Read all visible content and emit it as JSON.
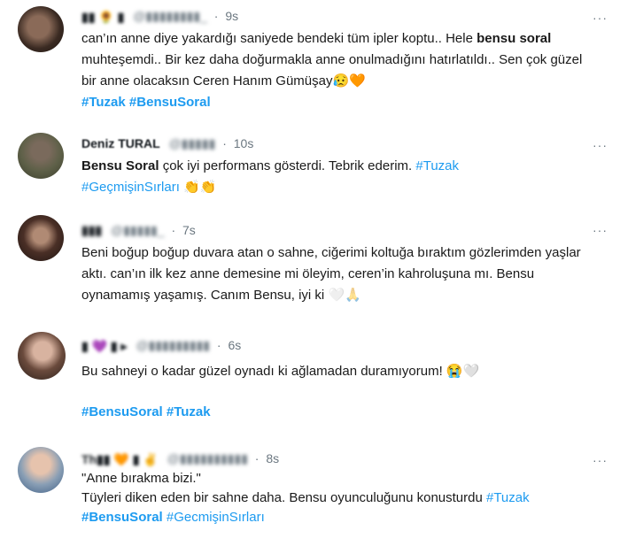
{
  "tweets": [
    {
      "time": "9s",
      "text_a": "can’ın anne diye yakardığı saniyede bendeki tüm ipler koptu.. Hele ",
      "text_bold": "bensu soral",
      "text_b": " muhteşemdi.. Bir kez daha doğurmakla anne onulmadığını hatırlatıldı.. Sen çok güzel bir anne olacaksın Ceren Hanım Gümüşay",
      "emojis": "😥🧡",
      "tags": [
        "#Tuzak",
        "#BensuSoral"
      ]
    },
    {
      "name": "Deniz TURAL",
      "time": "10s",
      "text_bold": "Bensu Soral",
      "text_a": " çok iyi performans gösterdi. Tebrik ederim. ",
      "tags": [
        "#Tuzak",
        "#GeçmişinSırları"
      ],
      "emojis": "👏👏"
    },
    {
      "time": "7s",
      "text": "Beni boğup boğup duvara atan o sahne, ciğerimi koltuğa bıraktım gözlerimden yaşlar aktı. can’ın ilk kez anne demesine mi öleyim, ceren’in kahroluşuna mı. Bensu oynamamış yaşamış. Canım Bensu, iyi ki",
      "emojis": "🤍🙏"
    },
    {
      "time": "6s",
      "text": "Bu sahneyi o kadar güzel oynadı ki ağlamadan duramıyorum!",
      "emojis": "😭🤍",
      "tags": [
        "#BensuSoral",
        "#Tuzak"
      ]
    },
    {
      "time": "8s",
      "quote": "\"Anne bırakma bizi.\"",
      "text": "Tüyleri diken eden bir sahne daha. Bensu oyunculuğunu konusturdu ",
      "tags": [
        "#Tuzak",
        "#BensuSoral",
        "#GecmişinSırları"
      ]
    }
  ],
  "more_label": "···",
  "dot": "·",
  "colors": {
    "hashtag": "#1d9bf0",
    "meta": "#6b7780",
    "text": "#1a1a1a"
  }
}
